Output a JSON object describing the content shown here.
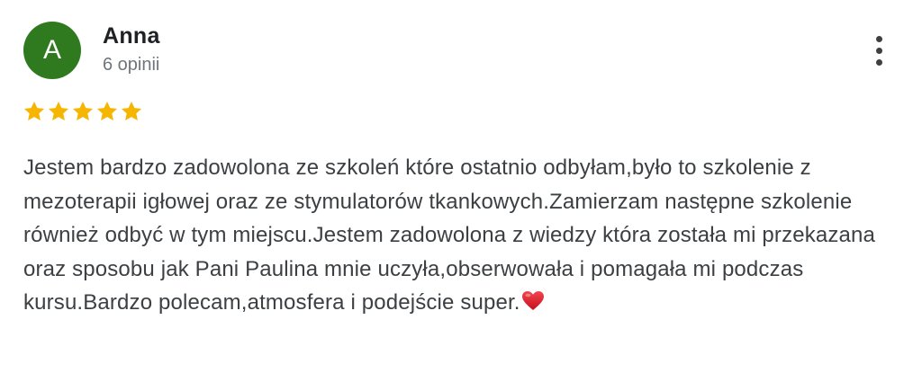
{
  "review": {
    "avatar_letter": "A",
    "avatar_color": "#2f7a1e",
    "author": "Anna",
    "review_count": "6 opinii",
    "rating": 5,
    "rating_max": 5,
    "star_color": "#f5b500",
    "text": "Jestem bardzo zadowolona ze szkoleń które ostatnio odbyłam,było to szkolenie z mezoterapii igłowej oraz ze stymulatorów tkankowych.Zamierzam następne szkolenie również odbyć w tym miejscu.Jestem zadowolona z wiedzy która została mi przekazana oraz sposobu jak Pani Paulina mnie uczyła,obserwowała i pomagała mi podczas kursu.Bardzo polecam,atmosfera i podejście super.",
    "trailing_icon": "red-heart-icon",
    "menu_icon": "more-vert-icon"
  }
}
